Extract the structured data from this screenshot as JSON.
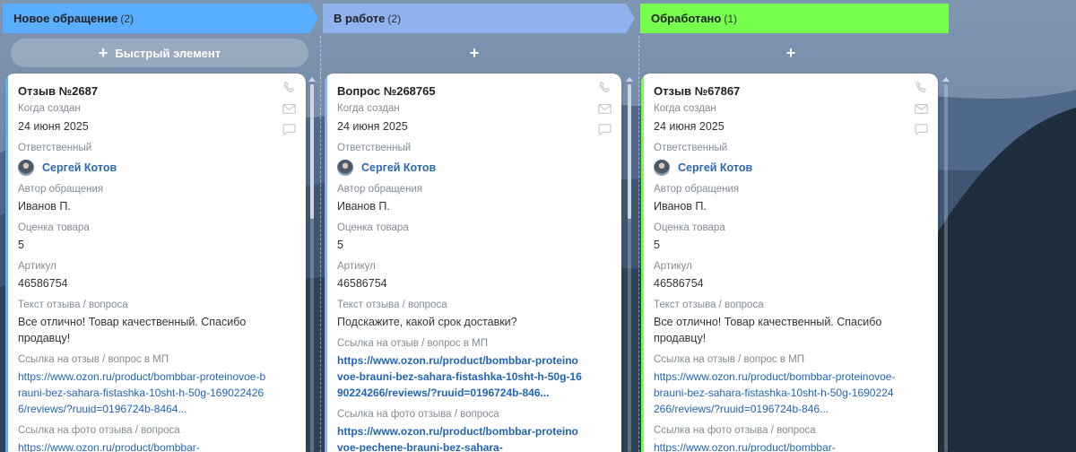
{
  "columns": [
    {
      "title": "Новое обращение",
      "count": "(2)",
      "color": "#5aaeff",
      "add_label": "Быстрый элемент",
      "card": {
        "title": "Отзыв №2687",
        "created_label": "Когда создан",
        "created_value": "24 июня 2025",
        "responsible_label": "Ответственный",
        "responsible_name": "Сергей Котов",
        "author_label": "Автор обращения",
        "author_value": "Иванов П.",
        "rating_label": "Оценка товара",
        "rating_value": "5",
        "article_label": "Артикул",
        "article_value": "46586754",
        "text_label": "Текст отзыва / вопроса",
        "text_value": "Все отлично! Товар качественный. Спасибо продавцу!",
        "link_label": "Ссылка на отзыв / вопрос в МП",
        "link_value": "https://www.ozon.ru/product/bombbar-proteinovoe-brauni-bez-sahara-fistashka-10sht-h-50g-1690224266/reviews/?ruuid=0196724b-8464...",
        "photo_label": "Ссылка на фото отзыва / вопроса",
        "photo_value": "https://www.ozon.ru/product/bombbar-"
      }
    },
    {
      "title": "В работе",
      "count": "(2)",
      "color": "#8fb2ef",
      "add_label": "",
      "card": {
        "title": "Вопрос №268765",
        "created_label": "Когда создан",
        "created_value": "24 июня 2025",
        "responsible_label": "Ответственный",
        "responsible_name": "Сергей Котов",
        "author_label": "Автор обращения",
        "author_value": "Иванов П.",
        "rating_label": "Оценка товара",
        "rating_value": "5",
        "article_label": "Артикул",
        "article_value": "46586754",
        "text_label": "Текст отзыва / вопроса",
        "text_value": "Подскажите, какой срок доставки?",
        "link_label": "Ссылка на отзыв / вопрос в МП",
        "link_value": "https://www.ozon.ru/product/bombbar-proteinovoe-brauni-bez-sahara-fistashka-10sht-h-50g-1690224266/reviews/?ruuid=0196724b-846...",
        "photo_label": "Ссылка на фото отзыва / вопроса",
        "photo_value": "https://www.ozon.ru/product/bombbar-proteinovoe-pechene-brauni-bez-sahara-"
      }
    },
    {
      "title": "Обработано",
      "count": "(1)",
      "color": "#77ff4e",
      "add_label": "",
      "card": {
        "title": "Отзыв №67867",
        "created_label": "Когда создан",
        "created_value": "24 июня 2025",
        "responsible_label": "Ответственный",
        "responsible_name": "Сергей Котов",
        "author_label": "Автор обращения",
        "author_value": "Иванов П.",
        "rating_label": "Оценка товара",
        "rating_value": "5",
        "article_label": "Артикул",
        "article_value": "46586754",
        "text_label": "Текст отзыва / вопроса",
        "text_value": "Все отлично! Товар качественный. Спасибо продавцу!",
        "link_label": "Ссылка на отзыв / вопрос в МП",
        "link_value": "https://www.ozon.ru/product/bombbar-proteinovoe-brauni-bez-sahara-fistashka-10sht-h-50g-1690224266/reviews/?ruuid=0196724b-846...",
        "photo_label": "Ссылка на фото отзыва / вопроса",
        "photo_value": "https://www.ozon.ru/product/bombbar-"
      }
    }
  ],
  "icons": {
    "add": "plus-icon",
    "call": "phone-icon",
    "email": "envelope-icon",
    "chat": "chat-bubble-icon"
  }
}
